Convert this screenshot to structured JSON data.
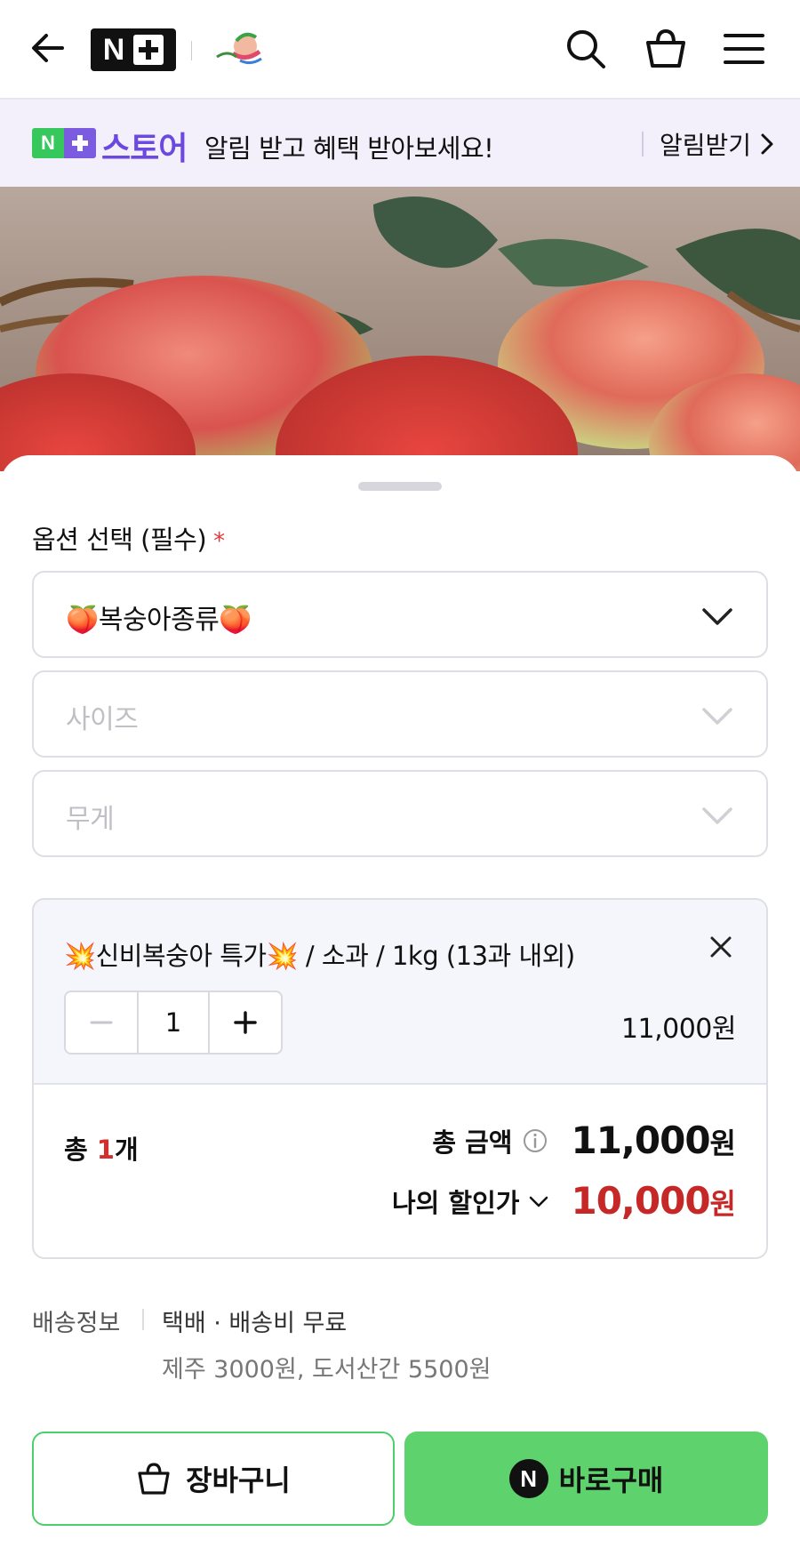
{
  "header": {
    "brand_letter": "N",
    "icons": [
      "back-arrow-icon",
      "search-icon",
      "shopping-bag-icon",
      "menu-icon"
    ]
  },
  "notice": {
    "badge_letter": "N",
    "store_label": "스토어",
    "message": "알림 받고 혜택 받아보세요!",
    "action_label": "알림받기"
  },
  "options": {
    "title": "옵션 선택 (필수)",
    "required_mark": "*",
    "selects": [
      {
        "value": "🍑복숭아종류🍑",
        "is_placeholder": false
      },
      {
        "value": "사이즈",
        "is_placeholder": true
      },
      {
        "value": "무게",
        "is_placeholder": true
      }
    ]
  },
  "selected_item": {
    "name": "💥신비복숭아 특가💥 / 소과 / 1kg (13과 내외)",
    "quantity": "1",
    "price": "11,000원"
  },
  "summary": {
    "count_prefix": "총 ",
    "count": "1",
    "count_suffix": "개",
    "total_label": "총 금액",
    "total_amount": "11,000",
    "total_unit": "원",
    "discount_label": "나의 할인가",
    "discount_amount": "10,000",
    "discount_unit": "원"
  },
  "shipping": {
    "label": "배송정보",
    "method": "택배 · 배송비 무료",
    "extra": "제주 3000원, 도서산간 5500원"
  },
  "actions": {
    "cart_label": "장바구니",
    "buy_badge": "N",
    "buy_label": "바로구매"
  },
  "colors": {
    "accent_green": "#5ed36d",
    "store_purple": "#6b48e0",
    "discount_red": "#c62828",
    "notice_bg": "#f3f0fb"
  }
}
